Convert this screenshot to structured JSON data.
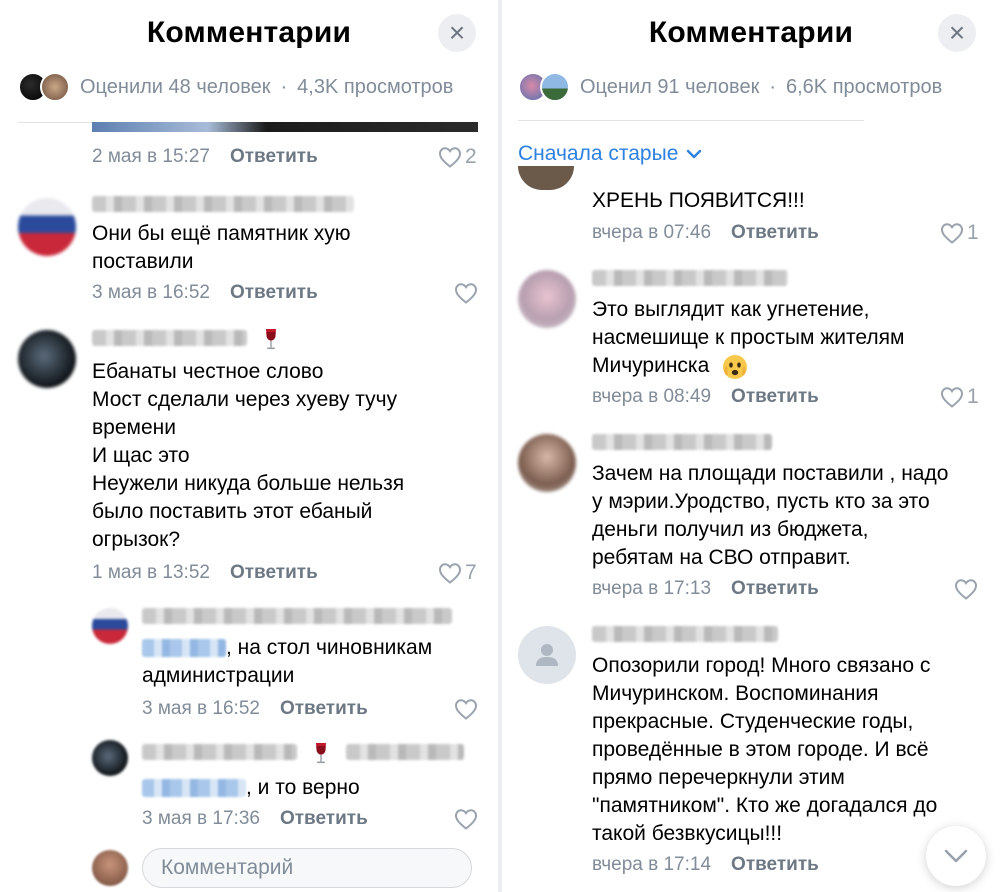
{
  "left": {
    "title": "Комментарии",
    "close_icon": "close-icon",
    "stats": {
      "rated": "Оценили 48 человек",
      "separator": "·",
      "views": "4,3K просмотров"
    },
    "top_comment_meta": {
      "date": "2 мая в 15:27",
      "reply": "Ответить",
      "likes": "2"
    },
    "comments": [
      {
        "text": "Они бы ещё памятник хую\nпоставили",
        "date": "3 мая в 16:52",
        "reply": "Ответить",
        "likes": ""
      },
      {
        "text": "Ебанаты честное слово\nМост сделали через хуеву тучу\nвремени\nИ щас это\nНеужели никуда больше нельзя\nбыло поставить этот ебаный\nогрызок?",
        "date": "1 мая в 13:52",
        "reply": "Ответить",
        "likes": "7"
      }
    ],
    "replies": [
      {
        "text": ", на стол чиновникам",
        "text2": "администрации",
        "date": "3 мая в 16:52",
        "reply": "Ответить",
        "likes": ""
      },
      {
        "text": ", и то верно",
        "date": "3 мая в 17:36",
        "reply": "Ответить",
        "likes": ""
      }
    ],
    "input_placeholder": "Комментарий"
  },
  "right": {
    "title": "Комментарии",
    "close_icon": "close-icon",
    "stats": {
      "rated": "Оценил 91 человек",
      "separator": "·",
      "views": "6,6K просмотров"
    },
    "sort_label": "Сначала старые",
    "top_comment": {
      "text": "ХРЕНЬ ПОЯВИТСЯ!!!",
      "date": "вчера в 07:46",
      "reply": "Ответить",
      "likes": "1"
    },
    "comments": [
      {
        "text": "Это выглядит как угнетение,\nнасмешище к простым жителям\nМичуринска",
        "date": "вчера в 08:49",
        "reply": "Ответить",
        "likes": "1"
      },
      {
        "text": "Зачем на площади поставили , надо\nу мэрии.Уродство, пусть кто за это\nденьги получил из бюджета,\nребятам на СВО отправит.",
        "date": "вчера в 17:13",
        "reply": "Ответить",
        "likes": ""
      },
      {
        "text": "Опозорили город! Много связано с\nМичуринском. Воспоминания\nпрекрасные. Студенческие годы,\nпроведённые в этом городе. И всё\nпрямо перечеркнули этим\n\"памятником\". Кто же догадался до\nтакой безвкусицы!!!",
        "date": "вчера в 17:14",
        "reply": "Ответить",
        "likes": ""
      }
    ]
  },
  "colors": {
    "accent": "#2d81e0",
    "secondary_text": "#818c99",
    "reply": "#6d7885"
  },
  "icons": {
    "heart": "heart-icon",
    "chevron": "chevron-down-icon",
    "user": "user-placeholder-icon",
    "wine": "wine-glass-icon",
    "emoji": "fearful-face-emoji"
  }
}
